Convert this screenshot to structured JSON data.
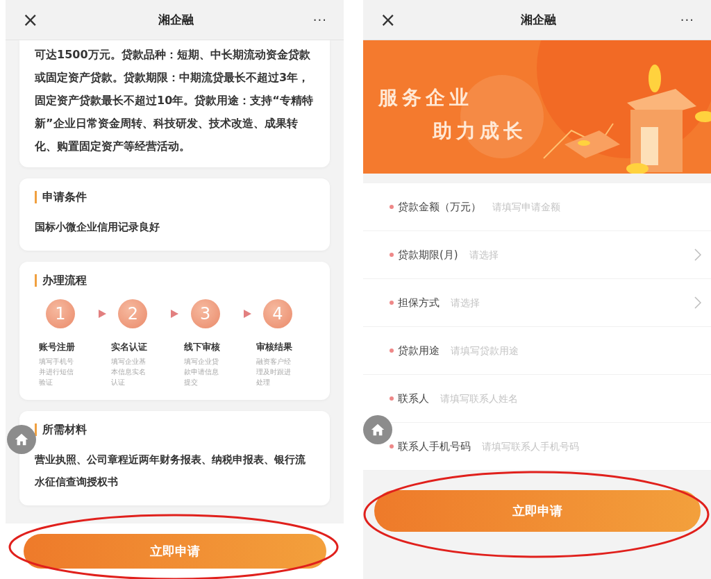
{
  "screens": [
    {
      "kind": "detail",
      "header": {
        "close": "×",
        "title": "湘企融",
        "more": "···"
      },
      "intro": "可达1500万元。贷款品种：短期、中长期流动资金贷款或固定资产贷款。贷款期限：中期流贷最长不超过3年，固定资产贷款最长不超过10年。贷款用途：支持“专精特新”企业日常资金周转、科技研发、技术改造、成果转化、购置固定资产等经营活动。",
      "sections": [
        {
          "kind": "text",
          "title": "申请条件",
          "text": "国标小微企业信用记录良好"
        },
        {
          "kind": "steps",
          "title": "办理流程",
          "steps": [
            {
              "number": "1",
              "title": "账号注册",
              "description": "填写手机号并进行短信验证"
            },
            {
              "number": "2",
              "title": "实名认证",
              "description": "填写企业基本信息实名认证"
            },
            {
              "number": "3",
              "title": "线下审核",
              "description": "填写企业贷款申请信息提交"
            },
            {
              "number": "4",
              "title": "审核结果",
              "description": "融资客户经理及时跟进处理"
            }
          ]
        },
        {
          "kind": "text",
          "title": "所需材料",
          "text": "营业执照、公司章程近两年财务报表、纳税申报表、银行流水征信查询授权书"
        }
      ],
      "button": {
        "label": "立即申请",
        "highlighted": true
      }
    },
    {
      "kind": "form",
      "header": {
        "close": "×",
        "title": "湘企融",
        "more": "···"
      },
      "banner": {
        "line_1": "服务企业",
        "line_2": "助力成长"
      },
      "fields": [
        {
          "kind": "input",
          "required": true,
          "label": "贷款金额（万元）",
          "placeholder": "请填写申请金额"
        },
        {
          "kind": "select",
          "required": true,
          "label": "贷款期限(月)",
          "placeholder": "请选择"
        },
        {
          "kind": "select",
          "required": true,
          "label": "担保方式",
          "placeholder": "请选择"
        },
        {
          "kind": "input",
          "required": true,
          "label": "贷款用途",
          "placeholder": "请填写贷款用途"
        },
        {
          "kind": "input",
          "required": true,
          "label": "联系人",
          "placeholder": "请填写联系人姓名"
        },
        {
          "kind": "input",
          "required": true,
          "label": "联系人手机号码",
          "placeholder": "请填写联系人手机号码"
        }
      ],
      "button": {
        "label": "立即申请",
        "highlighted": true
      }
    }
  ]
}
